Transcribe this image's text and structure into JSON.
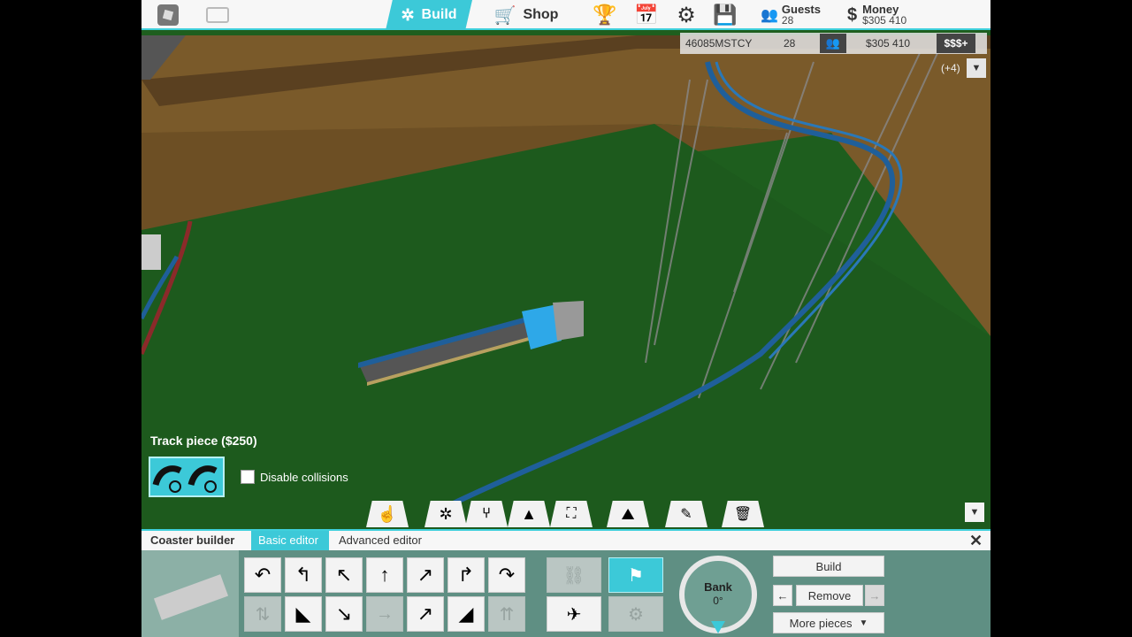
{
  "topbar": {
    "build_label": "Build",
    "shop_label": "Shop",
    "guests_label": "Guests",
    "guests_value": "28",
    "money_label": "Money",
    "money_value": "$305 410"
  },
  "infobar": {
    "park_code": "46085MSTCY",
    "guests": "28",
    "money": "$305 410",
    "more_count": "(+4)"
  },
  "track": {
    "title": "Track piece ($250)",
    "collisions_label": "Disable collisions"
  },
  "editor": {
    "tab_coaster": "Coaster builder",
    "tab_basic": "Basic editor",
    "tab_advanced": "Advanced editor",
    "bank_label": "Bank",
    "bank_value": "0°",
    "build_button": "Build",
    "remove_button": "Remove",
    "more_pieces": "More pieces"
  },
  "colors": {
    "accent": "#3cc9d8",
    "grass": "#1e5e1e",
    "dirt": "#7a5a2a",
    "track": "#1f5f9a"
  }
}
